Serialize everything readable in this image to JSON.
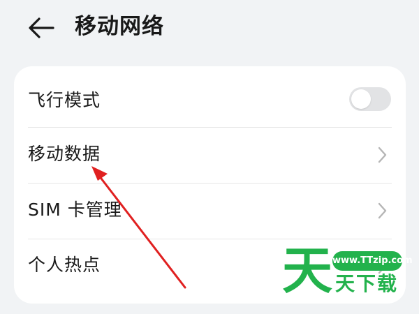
{
  "header": {
    "back_icon": "arrow-left-icon",
    "title": "移动网络"
  },
  "settings": {
    "items": [
      {
        "label": "飞行模式",
        "control": "toggle",
        "toggle_on": false
      },
      {
        "label": "移动数据",
        "control": "chevron",
        "icon": "chevron-right-icon"
      },
      {
        "label": "SIM 卡管理",
        "control": "chevron",
        "icon": "chevron-right-icon"
      },
      {
        "label": "个人热点",
        "control": "chevron",
        "icon": "chevron-right-icon"
      }
    ]
  },
  "annotation": {
    "arrow_color": "#e02020"
  },
  "watermark": {
    "url": "www.TTzip.com",
    "big_char": "天",
    "brand": "天下载",
    "color": "#22b24c"
  }
}
